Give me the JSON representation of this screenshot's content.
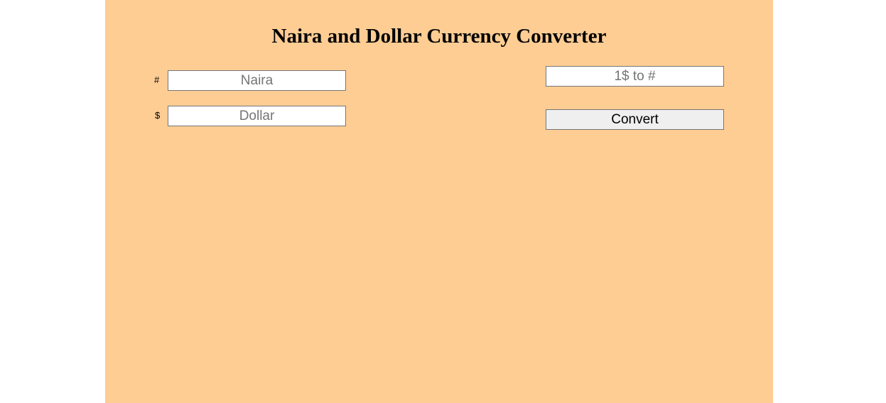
{
  "page": {
    "title": "Naira and Dollar Currency Converter"
  },
  "converter": {
    "naira_symbol": "#",
    "naira_placeholder": "Naira",
    "naira_value": "",
    "dollar_symbol": "$",
    "dollar_placeholder": "Dollar",
    "dollar_value": "",
    "rate_placeholder": "1$ to #",
    "rate_value": "",
    "convert_label": "Convert"
  },
  "colors": {
    "panel_background": "#fecd94",
    "page_background": "#ffffff",
    "button_background": "#efefef"
  }
}
